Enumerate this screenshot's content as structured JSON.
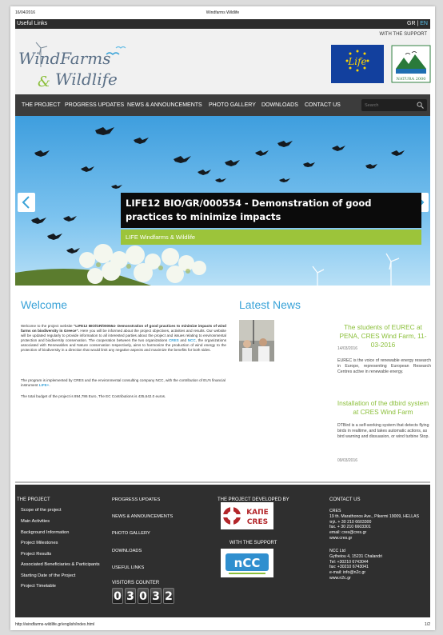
{
  "print_header": {
    "date": "16/04/2016",
    "title": "Windfarms Wildlife"
  },
  "util_bar": {
    "useful_links": "Useful Links",
    "lang_gr": "GR",
    "lang_sep": " | ",
    "lang_en": "EN"
  },
  "header": {
    "logo_line1": "WindFarms",
    "logo_amp": "&",
    "logo_line2": "Wildlife",
    "support_label": "WITH THE SUPPORT",
    "eu_logo_text": "Life",
    "natura_text": "NATURA 2000"
  },
  "nav": {
    "items": [
      "THE PROJECT",
      "PROGRESS UPDATES",
      "NEWS & ANNOUNCEMENTS",
      "PHOTO GALLERY",
      "DOWNLOADS",
      "CONTACT US"
    ],
    "search_placeholder": "Search"
  },
  "hero": {
    "title": "LIFE12 BIO/GR/000554 - Demonstration of good practices to minimize impacts",
    "subtitle": "LIFE Windfarms & Wildlife"
  },
  "welcome": {
    "title": "Welcome",
    "p1_a": "Welcome to the project website ",
    "p1_b": "\"LIFE12 BIO/GR/000554- Demonstration of good practices to minimize impacts of wind farms on biodiversity in Greece\".",
    "p1_c": " Here you will be informed about the project objectives, activities and results. Our website will be updated regularly to provide information to all interested parties about the project and issues relating to environmental protection and biodiversity conservation. The cooperation between the two organizations ",
    "p1_cres": "CRES",
    "p1_and": " and ",
    "p1_ncc": "NCC",
    "p1_d": ", the organizations associated with Renewables and Nature conservation respectively, aims to harmonize the production of wind energy to the protection of biodiversity in a direction that would limit any negative aspects and maximize the benefits for both sides.",
    "p2_a": "The program is implemented by CRES and the environmental consulting company NCC, with the contribution of EU's financial instrument ",
    "p2_life": "LIFE+",
    "p2_b": ".",
    "p3": "The total budget of the project is 894,786 Euro, The EC Contributions is 435,642.0 euros."
  },
  "latest": {
    "title": "Latest News",
    "news": [
      {
        "title": "The students of EUREC at PENA, CRES Wind Farm, 11-03-2016",
        "date": "14/03/2016",
        "text": "EUREC is the voice of renewable energy research in Europe, representing European Research Centres active in renewable energy."
      },
      {
        "title": "Installation of the dtbird system at CRES Wind Farm",
        "date": "09/03/2016",
        "text": "DTBird is a self-working system that detects flying birds in realtime, and takes automatic actions, as bird warning and dissuasion, or wind turbine Stop."
      }
    ]
  },
  "footer": {
    "col1_head": "THE PROJECT",
    "col1_links": [
      "Scope of the project",
      "Main Activities",
      "Background Information",
      "Project Milestones",
      "Project Results",
      "Associated Beneficiaries & Participants",
      "Starting Date of the Project",
      "Project Timetable"
    ],
    "col2_links": [
      "PROGRESS UPDATES",
      "NEWS & ANNOUNCEMENTS",
      "PHOTO GALLERY",
      "DOWNLOADS",
      "USEFUL LINKS"
    ],
    "counter_label": "VISITORS COUNTER",
    "counter_digits": [
      "0",
      "3",
      "0",
      "3",
      "2"
    ],
    "col3_head": "THE PROJECT DEVELOPED BY",
    "col3_support": "WITH THE SUPPORT",
    "cres_logo_top": "ΚΑΠΕ",
    "cres_logo_bottom": "CRES",
    "ncc_logo": "nCC",
    "col4_head": "CONTACT US",
    "contact1": [
      "CRES",
      "19 th. Marathonos Ave., Pikermi 19009, HELLAS",
      "τηλ. + 30 210 6603300",
      "fax. + 30 210 6603301",
      "email: cres@cres.gr",
      "www.cres.gr"
    ],
    "contact2": [
      "NCC Ltd",
      "Gytheiou 4, 15231 Chalandri",
      "Tel: +30210 6743044",
      "fax: +30210 6743041",
      "e-mail: info@n2c.gr",
      "www.n2c.gr"
    ]
  },
  "print_footer": {
    "url": "http://windfarms-wildlife.gr/english/index.html",
    "page": "1/2"
  },
  "colors": {
    "accent_blue": "#3aa3d8",
    "accent_green": "#9cc43a",
    "nav_bg": "#3c3c3c",
    "footer_bg": "#2f2f2f"
  }
}
